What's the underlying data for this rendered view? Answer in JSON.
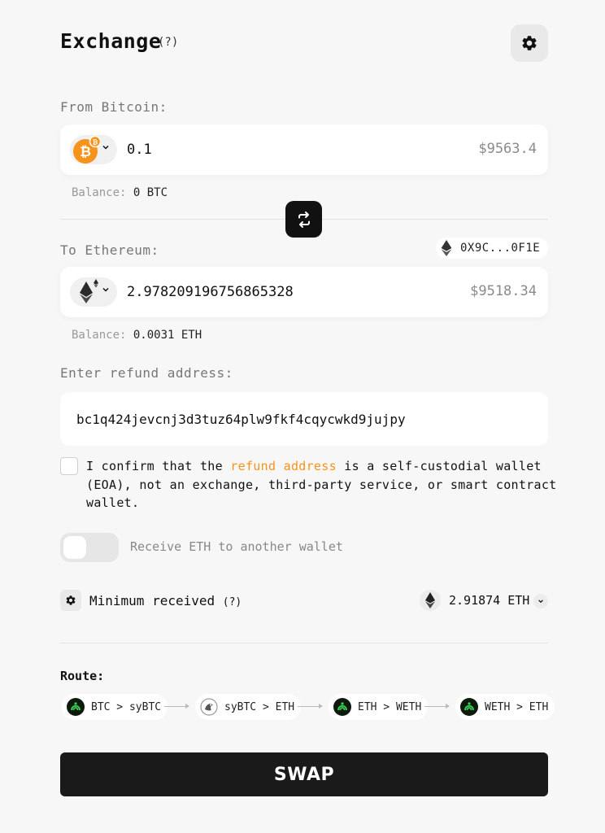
{
  "header": {
    "title": "Exchange",
    "help": "(?)"
  },
  "from": {
    "label": "From Bitcoin:",
    "amount": "0.1",
    "usd": "$9563.4",
    "balance_label": "Balance:",
    "balance_value": "0 BTC",
    "token_icon": "bitcoin-icon"
  },
  "to": {
    "label": "To Ethereum:",
    "address": "0X9C...0F1E",
    "amount": "2.978209196756865328",
    "usd": "$9518.34",
    "balance_label": "Balance:",
    "balance_value": "0.0031 ETH",
    "token_icon": "ethereum-icon"
  },
  "refund": {
    "label": "Enter refund address:",
    "value": "bc1q424jevcnj3d3tuz64plw9fkf4cqycwkd9jujpy"
  },
  "confirm": {
    "pre": "I confirm that the ",
    "link": "refund address",
    "post": " is a self-custodial wallet (EOA), not an exchange, third-party service, or smart contract wallet."
  },
  "toggle": {
    "label": "Receive ETH to another wallet",
    "on": false
  },
  "minimum": {
    "label": "Minimum received",
    "help": "(?)",
    "value": "2.91874 ETH"
  },
  "route": {
    "label": "Route:",
    "steps": [
      "BTC > syBTC",
      "syBTC > ETH",
      "ETH > WETH",
      "WETH > ETH"
    ]
  },
  "swap_button": "SWAP",
  "colors": {
    "accent": "#f7931a",
    "dark": "#111111",
    "bg": "#f7f7f7"
  }
}
